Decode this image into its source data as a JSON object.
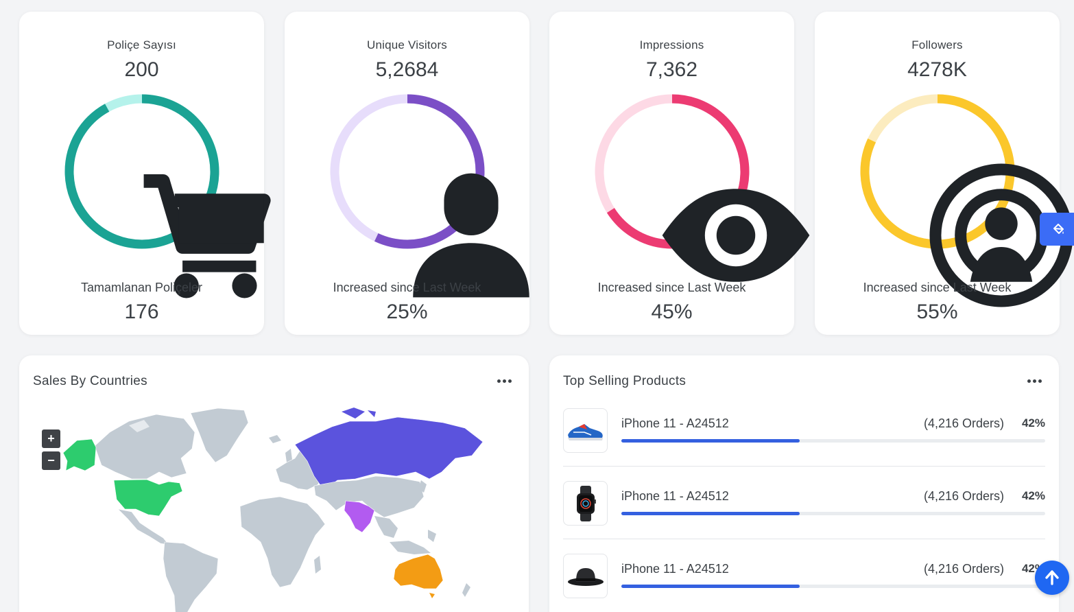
{
  "stats": [
    {
      "title": "Poliçe Sayısı",
      "value": "200",
      "subtitle": "Tamamlanan Poliçeler",
      "footer": "176",
      "icon": "cart-icon",
      "ring_color": "#1ba394",
      "track_color": "#b5f2eb",
      "progress": 0.92
    },
    {
      "title": "Unique Visitors",
      "value": "5,2684",
      "subtitle": "Increased since Last Week",
      "footer": "25%",
      "icon": "user-icon",
      "ring_color": "#7b4fc6",
      "track_color": "#e7ddfb",
      "progress": 0.57
    },
    {
      "title": "Impressions",
      "value": "7,362",
      "subtitle": "Increased since Last Week",
      "footer": "45%",
      "icon": "eye-icon",
      "ring_color": "#ec3b72",
      "track_color": "#fdd9e5",
      "progress": 0.66
    },
    {
      "title": "Followers",
      "value": "4278K",
      "subtitle": "Increased since Last Week",
      "footer": "55%",
      "icon": "broadcast-icon",
      "ring_color": "#fbc72b",
      "track_color": "#fcecbf",
      "progress": 0.82
    }
  ],
  "sales_by_countries": {
    "title": "Sales By Countries",
    "menu_icon": "more-horizontal-icon",
    "zoom_in_label": "+",
    "zoom_out_label": "−",
    "land_color": "#c2cbd3",
    "highlights": [
      {
        "region": "North America",
        "color": "#2dcc6e"
      },
      {
        "region": "Russia",
        "color": "#5b53dd"
      },
      {
        "region": "India",
        "color": "#b25bf0"
      },
      {
        "region": "Australia",
        "color": "#f39c14"
      }
    ]
  },
  "top_selling": {
    "title": "Top Selling Products",
    "menu_icon": "more-horizontal-icon",
    "progress_color": "#3460e0",
    "items": [
      {
        "name": "iPhone 11 - A24512",
        "orders": "(4,216 Orders)",
        "percent": "42%",
        "progress": 0.42,
        "image": "sneaker-image"
      },
      {
        "name": "iPhone 11 - A24512",
        "orders": "(4,216 Orders)",
        "percent": "42%",
        "progress": 0.42,
        "image": "smartwatch-image"
      },
      {
        "name": "iPhone 11 - A24512",
        "orders": "(4,216 Orders)",
        "percent": "42%",
        "progress": 0.42,
        "image": "hat-image"
      }
    ]
  },
  "floating": {
    "customizer_icon": "paint-bucket-icon",
    "back_to_top_icon": "arrow-up-icon"
  }
}
